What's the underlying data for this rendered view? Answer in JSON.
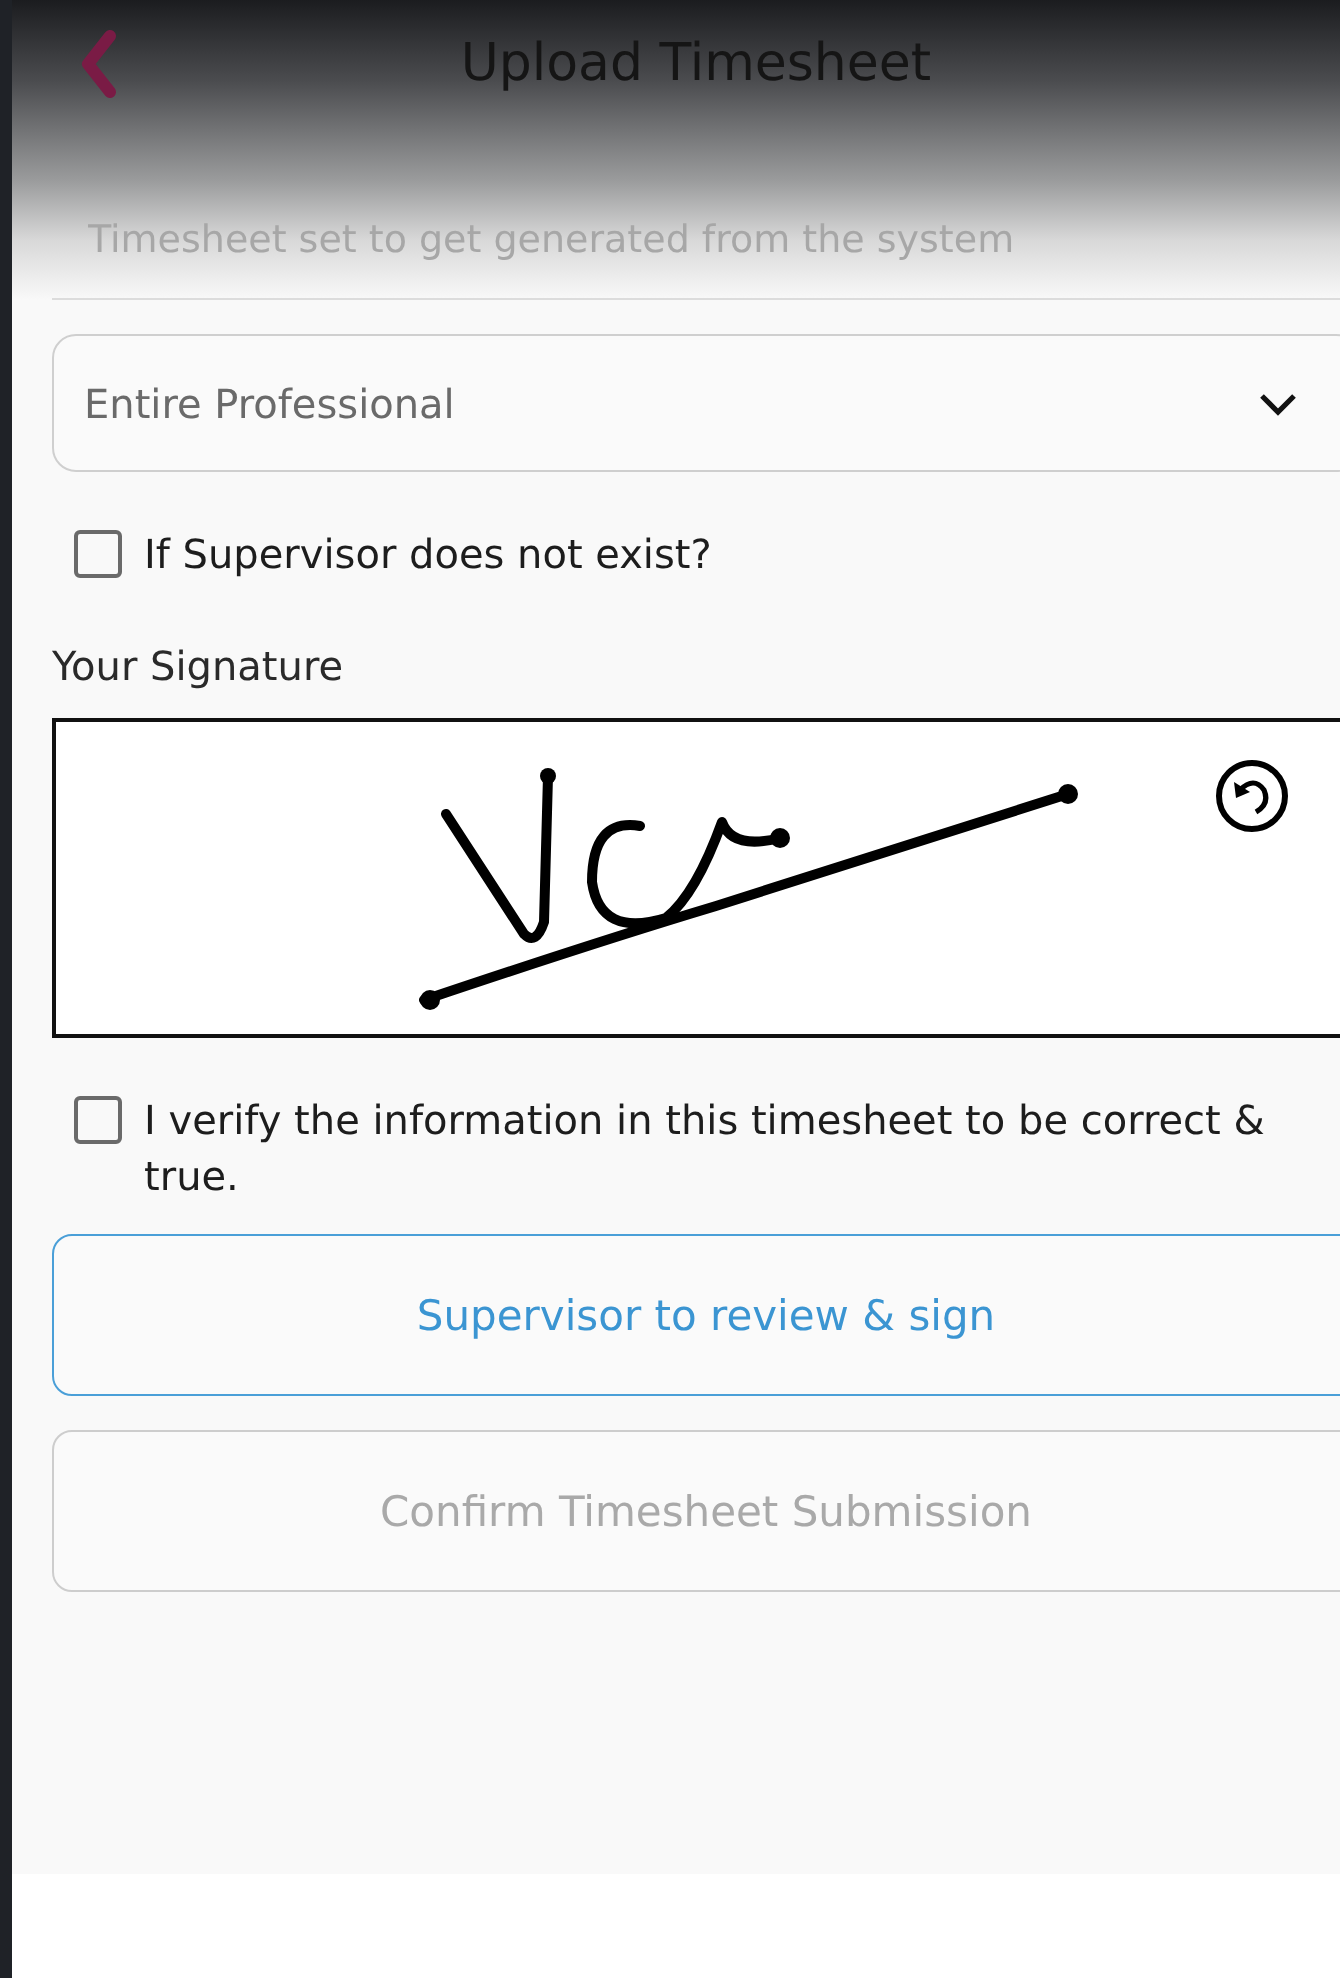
{
  "header": {
    "title": "Upload Timesheet"
  },
  "generation_field": {
    "placeholder": "Timesheet set to get generated from the system"
  },
  "professional_select": {
    "value": "Entire Professional"
  },
  "supervisor_missing": {
    "label": "If Supervisor does not exist?",
    "checked": false
  },
  "signature": {
    "label": "Your Signature"
  },
  "verify": {
    "label": "I verify the information in this timesheet to be correct & true.",
    "checked": false
  },
  "buttons": [
    {
      "label": "Supervisor to review & sign",
      "disabled": false
    },
    {
      "label": "Confirm Timesheet Submission",
      "disabled": true
    }
  ]
}
